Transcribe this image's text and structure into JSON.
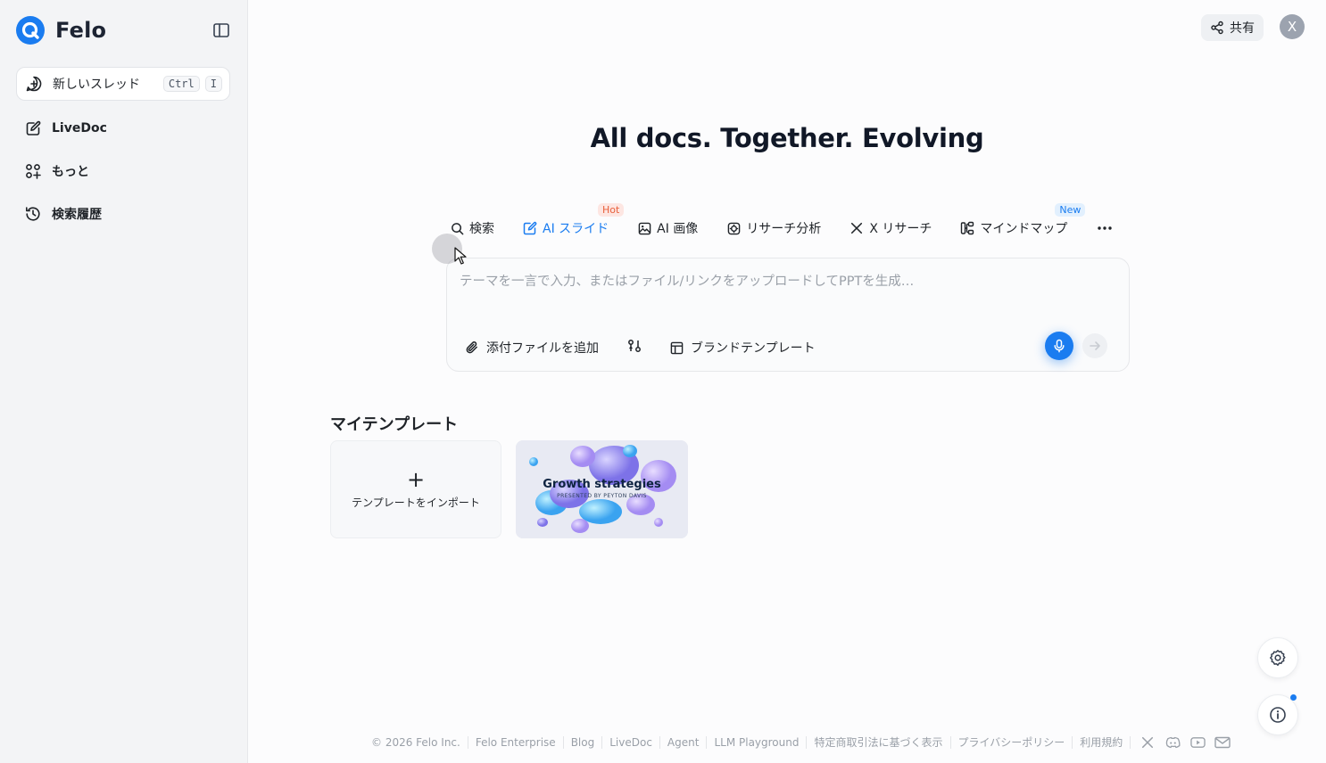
{
  "brand": {
    "name": "Felo",
    "accent": "#1a7cf0"
  },
  "sidebar": {
    "new_thread": {
      "label": "新しいスレッド",
      "shortcut_keys": [
        "Ctrl",
        "I"
      ]
    },
    "items": [
      {
        "label": "LiveDoc",
        "icon": "pen-icon"
      },
      {
        "label": "もっと",
        "icon": "apps-icon"
      },
      {
        "label": "検索履歴",
        "icon": "history-icon"
      }
    ]
  },
  "header": {
    "share_label": "共有",
    "avatar_initial": "X"
  },
  "main": {
    "headline": "All docs. Together. Evolving",
    "tabs": [
      {
        "label": "検索",
        "icon": "search-icon",
        "active": false,
        "badge": ""
      },
      {
        "label": "AI スライド",
        "icon": "slides-edit-icon",
        "active": true,
        "badge": "Hot"
      },
      {
        "label": "AI 画像",
        "icon": "image-icon",
        "active": false,
        "badge": ""
      },
      {
        "label": "リサーチ分析",
        "icon": "research-icon",
        "active": false,
        "badge": ""
      },
      {
        "label": "X リサーチ",
        "icon": "x-logo-icon",
        "active": false,
        "badge": ""
      },
      {
        "label": "マインドマップ",
        "icon": "mindmap-icon",
        "active": false,
        "badge": "New"
      }
    ],
    "composer": {
      "placeholder": "テーマを一言で入力、またはファイル/リンクをアップロードしてPPTを生成…",
      "value": "",
      "attach_label": "添付ファイルを追加",
      "brand_template_label": "ブランドテンプレート"
    },
    "templates": {
      "title": "マイテンプレート",
      "import_label": "テンプレートをインポート",
      "items": [
        {
          "title": "Growth strategies",
          "subtitle": "PRESENTED BY PEYTON DAVIS"
        }
      ]
    }
  },
  "footer": {
    "copyright": "© 2026 Felo Inc.",
    "links": [
      "Felo Enterprise",
      "Blog",
      "LiveDoc",
      "Agent",
      "LLM Playground",
      "特定商取引法に基づく表示",
      "プライバシーポリシー",
      "利用規約"
    ],
    "social_icons": [
      "x-logo-icon",
      "discord-icon",
      "youtube-icon",
      "mail-icon"
    ]
  }
}
